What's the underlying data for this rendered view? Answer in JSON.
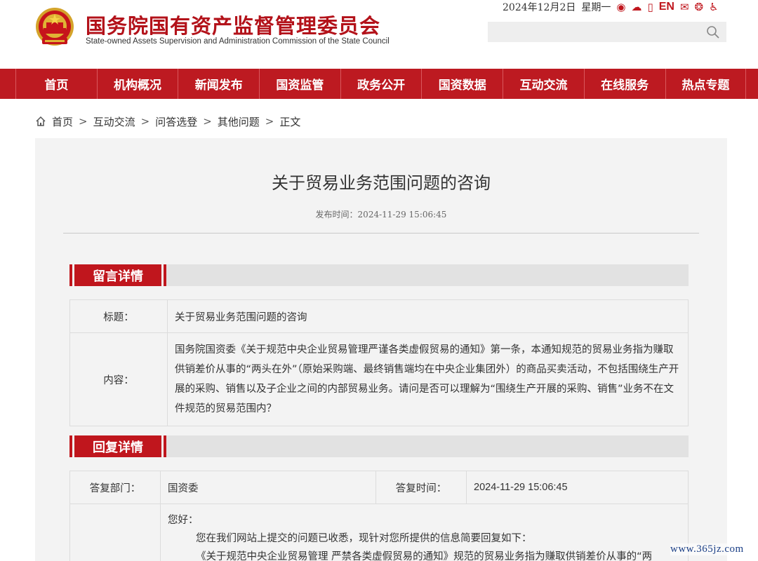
{
  "header": {
    "title": "国务院国有资产监督管理委员会",
    "subtitle": "State-owned Assets Supervision and Administration Commission of the State Council",
    "date": "2024年12月2日",
    "weekday": "星期一",
    "en_label": "EN",
    "search": {
      "placeholder": ""
    }
  },
  "nav": {
    "items": [
      "首页",
      "机构概况",
      "新闻发布",
      "国资监管",
      "政务公开",
      "国资数据",
      "互动交流",
      "在线服务",
      "热点专题"
    ]
  },
  "breadcrumb": {
    "items": [
      "首页",
      "互动交流",
      "问答选登",
      "其他问题"
    ],
    "current": "正文"
  },
  "article": {
    "title": "关于贸易业务范围问题的咨询",
    "pub_label": "发布时间：",
    "pub_time": "2024-11-29 15:06:45"
  },
  "message": {
    "section_title": "留言详情",
    "title_label": "标题：",
    "title_value": "关于贸易业务范围问题的咨询",
    "content_label": "内容：",
    "content_value": "国务院国资委《关于规范中央企业贸易管理严谨各类虚假贸易的通知》第一条，本通知规范的贸易业务指为赚取供销差价从事的“两头在外”（原始采购端、最终销售端均在中央企业集团外）的商品买卖活动，不包括围绕生产开展的采购、销售以及子企业之间的内部贸易业务。请问是否可以理解为“围绕生产开展的采购、销售”业务不在文件规范的贸易范围内？"
  },
  "reply": {
    "section_title": "回复详情",
    "dept_label": "答复部门：",
    "dept_value": "国资委",
    "time_label": "答复时间：",
    "time_value": "2024-11-29 15:06:45",
    "greeting": "您好：",
    "para1": "您在我们网站上提交的问题已收悉，现针对您所提供的信息简要回复如下：",
    "para2": "《关于规范中央企业贸易管理 严禁各类虚假贸易的通知》规范的贸易业务指为赚取供销差价从事的“两"
  },
  "watermark": "www.365jz.com",
  "colors": {
    "brand_red": "#bd1a21",
    "panel_bg": "#f3f3f3",
    "section_bar": "#e2e2e2"
  }
}
